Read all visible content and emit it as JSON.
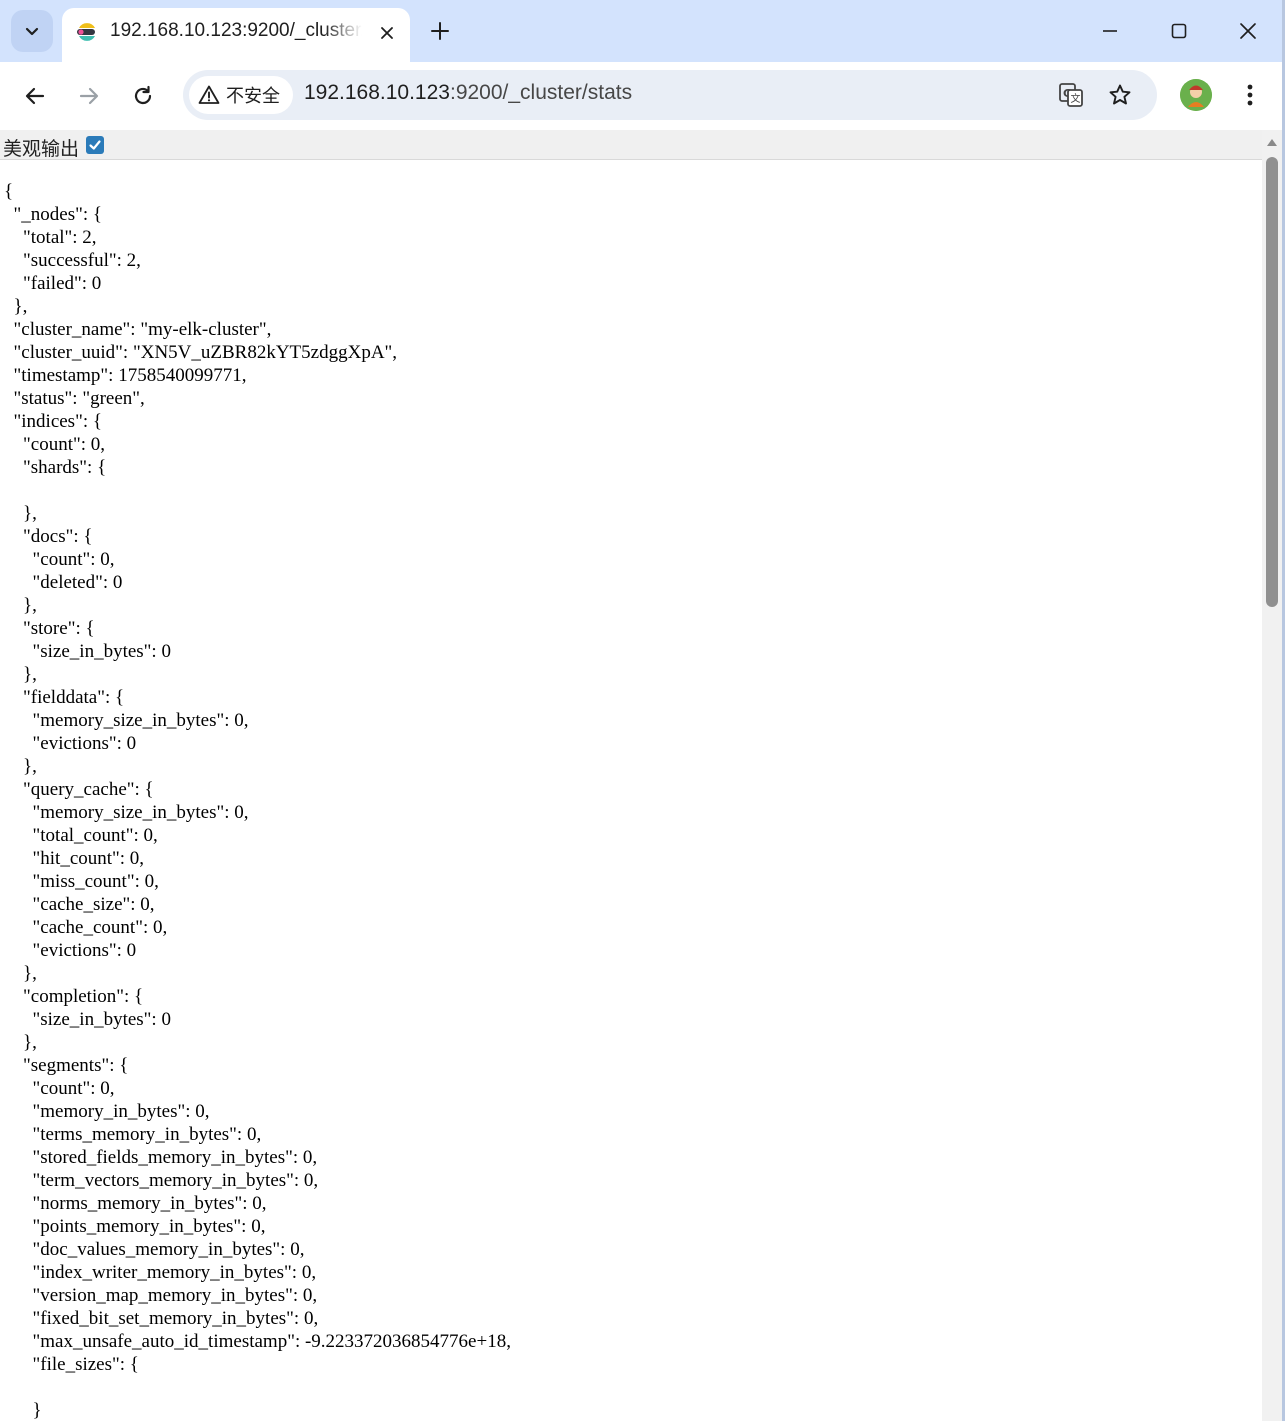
{
  "browser": {
    "tab": {
      "title": "192.168.10.123:9200/_cluster/stats",
      "favicon": "elasticsearch-icon"
    },
    "window_controls": [
      "minimize",
      "maximize",
      "close"
    ],
    "address_bar": {
      "security_label": "不安全",
      "url_host": "192.168.10.123",
      "url_path": ":9200/_cluster/stats"
    },
    "icons": {
      "translate": "google-translate-icon",
      "bookmark": "star-icon",
      "profile": "profile-avatar",
      "menu": "more-vert-icon"
    }
  },
  "page": {
    "pretty_print_label": "美观输出",
    "pretty_print_checked": true,
    "json_lines": [
      "{",
      "  \"_nodes\": {",
      "    \"total\": 2,",
      "    \"successful\": 2,",
      "    \"failed\": 0",
      "  },",
      "  \"cluster_name\": \"my-elk-cluster\",",
      "  \"cluster_uuid\": \"XN5V_uZBR82kYT5zdggXpA\",",
      "  \"timestamp\": 1758540099771,",
      "  \"status\": \"green\",",
      "  \"indices\": {",
      "    \"count\": 0,",
      "    \"shards\": {",
      "",
      "    },",
      "    \"docs\": {",
      "      \"count\": 0,",
      "      \"deleted\": 0",
      "    },",
      "    \"store\": {",
      "      \"size_in_bytes\": 0",
      "    },",
      "    \"fielddata\": {",
      "      \"memory_size_in_bytes\": 0,",
      "      \"evictions\": 0",
      "    },",
      "    \"query_cache\": {",
      "      \"memory_size_in_bytes\": 0,",
      "      \"total_count\": 0,",
      "      \"hit_count\": 0,",
      "      \"miss_count\": 0,",
      "      \"cache_size\": 0,",
      "      \"cache_count\": 0,",
      "      \"evictions\": 0",
      "    },",
      "    \"completion\": {",
      "      \"size_in_bytes\": 0",
      "    },",
      "    \"segments\": {",
      "      \"count\": 0,",
      "      \"memory_in_bytes\": 0,",
      "      \"terms_memory_in_bytes\": 0,",
      "      \"stored_fields_memory_in_bytes\": 0,",
      "      \"term_vectors_memory_in_bytes\": 0,",
      "      \"norms_memory_in_bytes\": 0,",
      "      \"points_memory_in_bytes\": 0,",
      "      \"doc_values_memory_in_bytes\": 0,",
      "      \"index_writer_memory_in_bytes\": 0,",
      "      \"version_map_memory_in_bytes\": 0,",
      "      \"fixed_bit_set_memory_in_bytes\": 0,",
      "      \"max_unsafe_auto_id_timestamp\": -9.223372036854776e+18,",
      "      \"file_sizes\": {",
      "",
      "      }"
    ]
  },
  "colors": {
    "tabstrip": "#d3e3fd",
    "omnibox": "#e9eef6",
    "checkbox": "#2b7bb9"
  }
}
